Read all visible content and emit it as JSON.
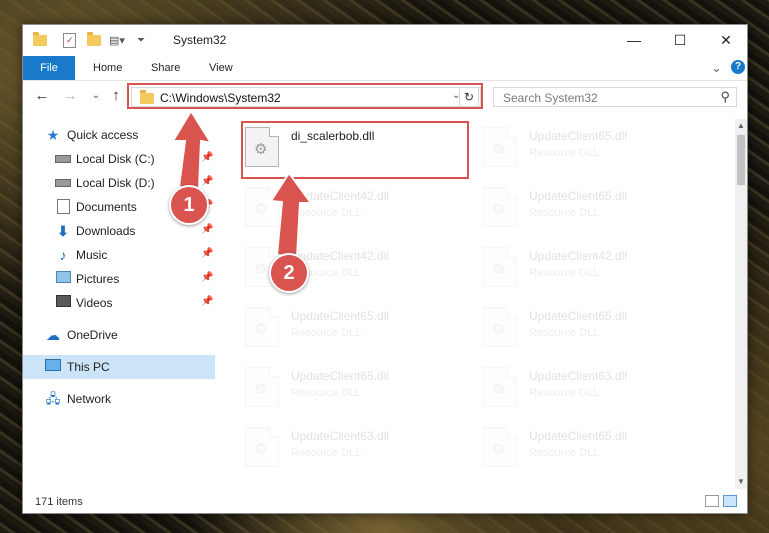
{
  "window": {
    "title": "System32",
    "controls": {
      "minimize": "—",
      "maximize": "☐",
      "close": "✕"
    }
  },
  "ribbon": {
    "tabs": [
      "File",
      "Home",
      "Share",
      "View"
    ],
    "expand_icon": "⌄",
    "help_icon": "?"
  },
  "navigation": {
    "back": "←",
    "forward": "→",
    "recent": "⌄",
    "up": "↑",
    "address": "C:\\Windows\\System32",
    "address_dropdown": "⌄",
    "refresh": "↻",
    "search_placeholder": "Search System32",
    "search_icon": "⚲"
  },
  "sidebar": {
    "items": [
      {
        "label": "Quick access",
        "icon": "star-icon",
        "pinned": false
      },
      {
        "label": "Local Disk (C:)",
        "icon": "drive-icon",
        "pinned": true
      },
      {
        "label": "Local Disk (D:)",
        "icon": "drive-icon",
        "pinned": true
      },
      {
        "label": "Documents",
        "icon": "documents-icon",
        "pinned": true
      },
      {
        "label": "Downloads",
        "icon": "downloads-icon",
        "pinned": true
      },
      {
        "label": "Music",
        "icon": "music-icon",
        "pinned": true
      },
      {
        "label": "Pictures",
        "icon": "pictures-icon",
        "pinned": true
      },
      {
        "label": "Videos",
        "icon": "videos-icon",
        "pinned": true
      },
      {
        "label": "OneDrive",
        "icon": "cloud-icon",
        "pinned": false
      },
      {
        "label": "This PC",
        "icon": "computer-icon",
        "pinned": false,
        "selected": true
      },
      {
        "label": "Network",
        "icon": "network-icon",
        "pinned": false
      }
    ]
  },
  "files": [
    {
      "name": "di_scalerbob.dll",
      "type": "",
      "highlighted": true
    },
    {
      "name": "UpdateClient65.dll",
      "type": "Resource DLL"
    },
    {
      "name": "UpdateClient42.dll",
      "type": "Resource DLL"
    },
    {
      "name": "UpdateClient65.dll",
      "type": "Resource DLL"
    },
    {
      "name": "UpdateClient42.dll",
      "type": "Resource DLL"
    },
    {
      "name": "UpdateClient42.dll",
      "type": "Resource DLL"
    },
    {
      "name": "UpdateClient65.dll",
      "type": "Resource DLL"
    },
    {
      "name": "UpdateClient65.dll",
      "type": "Resource DLL"
    },
    {
      "name": "UpdateClient65.dll",
      "type": "Resource DLL"
    },
    {
      "name": "UpdateClient63.dll",
      "type": "Resource DLL"
    },
    {
      "name": "UpdateClient63.dll",
      "type": "Resource DLL"
    },
    {
      "name": "UpdateClient65.dll",
      "type": "Resource DLL"
    }
  ],
  "status": {
    "item_count": "171 items"
  },
  "annotations": {
    "step1": "1",
    "step2": "2"
  },
  "colors": {
    "accent": "#1979ca",
    "highlight": "#d9534f",
    "selected": "#cce4f7"
  }
}
